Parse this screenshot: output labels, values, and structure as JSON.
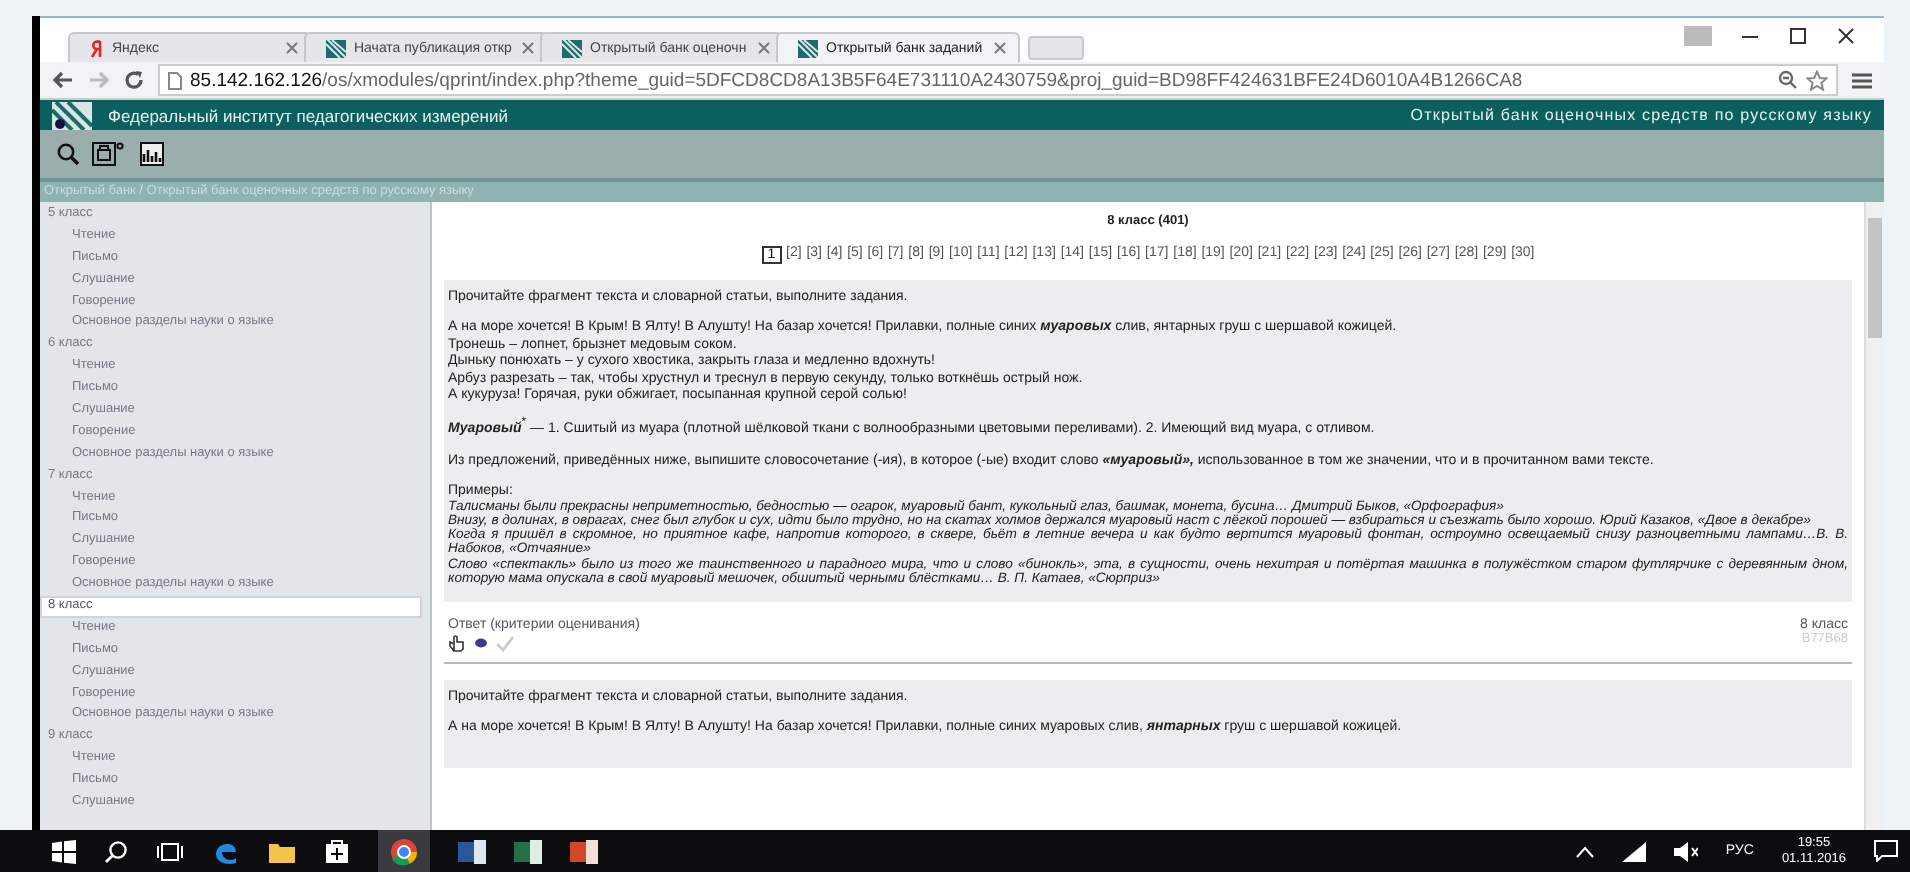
{
  "browser": {
    "tabs": [
      {
        "label": "Яндекс",
        "kind": "yandex",
        "selected": false
      },
      {
        "label": "Начата публикация откр",
        "kind": "site",
        "selected": false
      },
      {
        "label": "Открытый банк оценочн",
        "kind": "site",
        "selected": false
      },
      {
        "label": "Открытый банк заданий",
        "kind": "site",
        "selected": true
      }
    ],
    "url_host": "85.142.162.126",
    "url_path": "/os/xmodules/qprint/index.php?theme_guid=5DFCD8CD8A13B5F64E731110A2430759&proj_guid=BD98FF424631BFE24D6010A4B1266CA8"
  },
  "header": {
    "title": "Федеральный институт педагогических измерений",
    "subtitle": "Открытый банк оценочных средств по русскому языку"
  },
  "breadcrumb": "Открытый банк / Открытый банк оценочных средств по русскому языку",
  "sidebar": {
    "items": [
      {
        "label": "5 класс",
        "selected": false,
        "children": [
          {
            "label": "Чтение",
            "selected": false
          },
          {
            "label": "Письмо",
            "selected": false
          },
          {
            "label": "Слушание",
            "selected": false
          },
          {
            "label": "Говорение",
            "selected": false
          },
          {
            "label": "Основное разделы науки о языке",
            "selected": false
          }
        ]
      },
      {
        "label": "6 класс",
        "selected": false,
        "children": [
          {
            "label": "Чтение",
            "selected": false
          },
          {
            "label": "Письмо",
            "selected": false
          },
          {
            "label": "Слушание",
            "selected": false
          },
          {
            "label": "Говорение",
            "selected": false
          },
          {
            "label": "Основное разделы науки о языке",
            "selected": false
          }
        ]
      },
      {
        "label": "7 класс",
        "selected": false,
        "children": [
          {
            "label": "Чтение",
            "selected": false
          },
          {
            "label": "Письмо",
            "selected": false
          },
          {
            "label": "Слушание",
            "selected": false
          },
          {
            "label": "Говорение",
            "selected": false
          },
          {
            "label": "Основное разделы науки о языке",
            "selected": false
          }
        ]
      },
      {
        "label": "8 класс",
        "selected": true,
        "children": [
          {
            "label": "Чтение",
            "selected": false
          },
          {
            "label": "Письмо",
            "selected": false
          },
          {
            "label": "Слушание",
            "selected": false
          },
          {
            "label": "Говорение",
            "selected": false
          },
          {
            "label": "Основное разделы науки о языке",
            "selected": false
          }
        ]
      },
      {
        "label": "9 класс",
        "selected": false,
        "children": [
          {
            "label": "Чтение",
            "selected": false
          },
          {
            "label": "Письмо",
            "selected": false
          },
          {
            "label": "Слушание",
            "selected": false
          }
        ]
      }
    ]
  },
  "content": {
    "heading": "8 класс (401)",
    "pages": [
      {
        "label": "1",
        "selected": true
      },
      {
        "label": "[2]",
        "selected": false
      },
      {
        "label": "[3]",
        "selected": false
      },
      {
        "label": "[4]",
        "selected": false
      },
      {
        "label": "[5]",
        "selected": false
      },
      {
        "label": "[6]",
        "selected": false
      },
      {
        "label": "[7]",
        "selected": false
      },
      {
        "label": "[8]",
        "selected": false
      },
      {
        "label": "[9]",
        "selected": false
      },
      {
        "label": "[10]",
        "selected": false
      },
      {
        "label": "[11]",
        "selected": false
      },
      {
        "label": "[12]",
        "selected": false
      },
      {
        "label": "[13]",
        "selected": false
      },
      {
        "label": "[14]",
        "selected": false
      },
      {
        "label": "[15]",
        "selected": false
      },
      {
        "label": "[16]",
        "selected": false
      },
      {
        "label": "[17]",
        "selected": false
      },
      {
        "label": "[18]",
        "selected": false
      },
      {
        "label": "[19]",
        "selected": false
      },
      {
        "label": "[20]",
        "selected": false
      },
      {
        "label": "[21]",
        "selected": false
      },
      {
        "label": "[22]",
        "selected": false
      },
      {
        "label": "[23]",
        "selected": false
      },
      {
        "label": "[24]",
        "selected": false
      },
      {
        "label": "[25]",
        "selected": false
      },
      {
        "label": "[26]",
        "selected": false
      },
      {
        "label": "[27]",
        "selected": false
      },
      {
        "label": "[28]",
        "selected": false
      },
      {
        "label": "[29]",
        "selected": false
      },
      {
        "label": "[30]",
        "selected": false
      }
    ],
    "tasks": [
      {
        "instruction": "Прочитайте фрагмент текста и словарной статьи, выполните задания.",
        "passage": [
          "А на море хочется! В Крым! В Ялту! В Алушту! На базар хочется! Прилавки, полные синих **муаровых** слив, янтарных груш с шершавой кожицей.",
          "Тронешь – лопнет, брызнет медовым соком.",
          "Дыньку понюхать – у сухого хвостика, закрыть глаза и медленно вдохнуть!",
          "Арбуз разрезать – так, чтобы хрустнул и треснул в первую секунду, только воткнёшь острый нож.",
          "А кукуруза! Горячая, руки обжигает, посыпанная крупной серой солью!"
        ],
        "definition": "**Муаровый**$^{*}$ — 1. Сшитый из муара (плотной шёлковой ткани с волнообразными цветовыми переливами). 2. Имеющий вид муара, с отливом.",
        "question": "Из предложений, приведённых ниже, выпишите словосочетание (-ия), в которое (-ые) входит слово **«муаровый»,** использованное в том же значении, что и в прочитанном вами тексте.",
        "examples_label": "Примеры:",
        "examples": [
          "Талисманы были прекрасны неприметностью, бедностью — огарок, муаровый бант, кукольный глаз, башмак, монета, бусина… Дмитрий Быков, «Орфография»",
          "Внизу, в долинах, в оврагах, снег был глубок и сух, идти было трудно, но на скатах холмов держался муаровый наст с лёгкой порошей — взбираться и съезжать было хорошо. Юрий Казаков, «Двое в декабре»",
          "Когда я пришёл в скромное, но приятное кафе, напротив которого, в сквере, бьёт в летние вечера и как будто вертится муаровый фонтан, остроумно освещаемый снизу разноцветными лампами…В. В. Набоков, «Отчаяние»",
          "Слово «спектакль» было из того же таинственного и парадного мира, что и слово «бинокль», эта, в сущности, очень нехитрая и потёртая машинка в полужёстком старом футлярчике с деревянным дном, которую мама опускала в свой муаровый мешочек, обшитый черными блёстками… В. П. Катаев, «Сюрприз»"
        ],
        "answer_link": "Ответ (критерии оценивания)",
        "grade": "8 класс",
        "code": "B77B68"
      },
      {
        "instruction": "Прочитайте фрагмент текста и словарной статьи, выполните задания.",
        "passage": [
          "А на море хочется! В Крым! В Ялту! В Алушту! На базар хочется! Прилавки, полные синих муаровых слив, **янтарных** груш с шершавой кожицей."
        ]
      }
    ]
  },
  "taskbar": {
    "language": "РУС",
    "time": "19:55",
    "date": "01.11.2016"
  }
}
